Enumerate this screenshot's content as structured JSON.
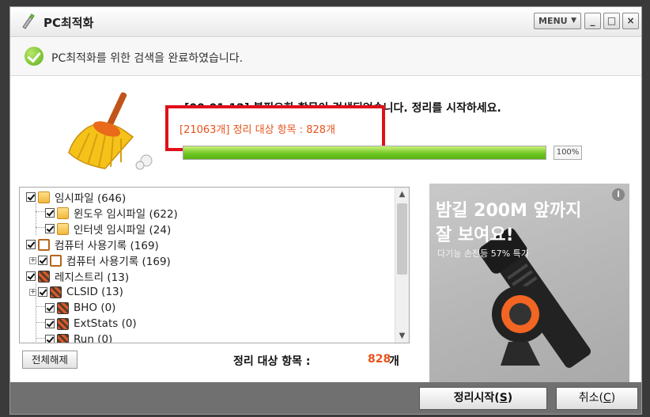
{
  "window": {
    "title": "PC최적화",
    "menu_label": "MENU",
    "minimize": "_",
    "maximize": "□",
    "close": "×"
  },
  "status": {
    "message": "PC최적화를 위한 검색을 완료하였습니다."
  },
  "scan": {
    "main_message": "[00:01:12] 불필요한 항목이 검색되었습니다. 정리를 시작하세요.",
    "sub_message": "[21063개] 정리 대상 항목 : 828개",
    "progress_percent": 100,
    "progress_label": "100%"
  },
  "tree": {
    "items": [
      {
        "label": "임시파일 (646)",
        "icon": "folder-icon"
      },
      {
        "label": "윈도우 임시파일 (622)",
        "icon": "folder-icon"
      },
      {
        "label": "인터넷 임시파일 (24)",
        "icon": "folder-icon"
      },
      {
        "label": "컴퓨터 사용기록 (169)",
        "icon": "document-icon"
      },
      {
        "label": "컴퓨터 사용기록 (169)",
        "icon": "document-icon"
      },
      {
        "label": "레지스트리 (13)",
        "icon": "registry-icon"
      },
      {
        "label": "CLSID (13)",
        "icon": "registry-icon"
      },
      {
        "label": "BHO (0)",
        "icon": "registry-icon"
      },
      {
        "label": "ExtStats (0)",
        "icon": "registry-icon"
      },
      {
        "label": "Run (0)",
        "icon": "registry-icon"
      }
    ]
  },
  "bottom": {
    "uncheck_all": "전체해제",
    "summary_label": "정리 대상 항목 :",
    "summary_count": "828",
    "summary_unit": "개"
  },
  "ad": {
    "title_line1": "밤길 200M 앞까지",
    "title_line2": "잘 보여요!",
    "subtitle": "다기능 손전등 57% 특가",
    "info": "i"
  },
  "footer": {
    "start_label": "정리시작(",
    "start_key": "S",
    "start_end": ")",
    "cancel_label": "취소(",
    "cancel_key": "C",
    "cancel_end": ")"
  }
}
